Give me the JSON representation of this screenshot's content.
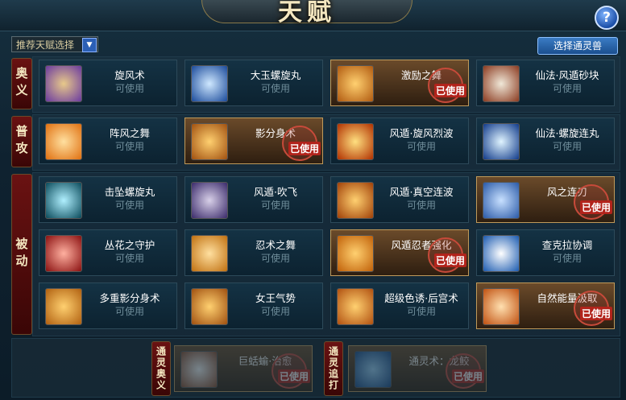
{
  "window": {
    "title": "天赋",
    "help_icon": "?"
  },
  "toolbar": {
    "recommend_select": "推荐天赋选择",
    "select_summon_button": "选择通灵兽"
  },
  "categories": {
    "ougi": "奥义",
    "attack": "普攻",
    "passive": "被动",
    "summon_ougi": "通灵奥义",
    "summon_chase": "通灵追打"
  },
  "status_labels": {
    "available": "可使用",
    "used": "已使用"
  },
  "ougi": [
    {
      "name": "旋风术",
      "status": "可使用",
      "used": false,
      "icon": "tornado-icon"
    },
    {
      "name": "大玉螺旋丸",
      "status": "可使用",
      "used": false,
      "icon": "swirl-icon"
    },
    {
      "name": "激励之舞",
      "status": "已使用",
      "used": true,
      "icon": "dance-icon"
    },
    {
      "name": "仙法·风遁砂块",
      "status": "可使用",
      "used": false,
      "icon": "wind-sand-icon"
    }
  ],
  "attack": [
    {
      "name": "阵风之舞",
      "status": "可使用",
      "used": false,
      "icon": "gust-icon"
    },
    {
      "name": "影分身术",
      "status": "已使用",
      "used": true,
      "icon": "clone-icon"
    },
    {
      "name": "风遁·旋风烈波",
      "status": "可使用",
      "used": false,
      "icon": "slash-icon"
    },
    {
      "name": "仙法·螺旋连丸",
      "status": "可使用",
      "used": false,
      "icon": "rasengan-icon"
    }
  ],
  "passive": [
    {
      "name": "击坠螺旋丸",
      "status": "可使用",
      "used": false,
      "icon": "vortex-icon"
    },
    {
      "name": "风遁·吹飞",
      "status": "可使用",
      "used": false,
      "icon": "fan-icon"
    },
    {
      "name": "风遁·真空连波",
      "status": "可使用",
      "used": false,
      "icon": "wave-icon"
    },
    {
      "name": "风之连刃",
      "status": "已使用",
      "used": true,
      "icon": "blade-icon"
    },
    {
      "name": "丛花之守护",
      "status": "可使用",
      "used": false,
      "icon": "flower-guard-icon"
    },
    {
      "name": "忍术之舞",
      "status": "可使用",
      "used": false,
      "icon": "scroll-icon"
    },
    {
      "name": "风遁忍者强化",
      "status": "已使用",
      "used": true,
      "icon": "wind-kanji-icon"
    },
    {
      "name": "查克拉协调",
      "status": "可使用",
      "used": false,
      "icon": "hand-icon"
    },
    {
      "name": "多重影分身术",
      "status": "可使用",
      "used": false,
      "icon": "multi-clone-icon"
    },
    {
      "name": "女王气势",
      "status": "可使用",
      "used": false,
      "icon": "queen-icon"
    },
    {
      "name": "超级色诱·后宫术",
      "status": "可使用",
      "used": false,
      "icon": "sexy-jutsu-icon"
    },
    {
      "name": "自然能量汲取",
      "status": "已使用",
      "used": true,
      "icon": "clock-icon"
    }
  ],
  "summon": [
    {
      "name": "巨蛞蝓·治愈",
      "status": "已使用",
      "used": true,
      "icon": "slug-icon"
    },
    {
      "name": "通灵术：龙鲛",
      "status": "已使用",
      "used": true,
      "icon": "shark-icon"
    }
  ],
  "colors": {
    "card_available": "#0c2230",
    "card_used": "#6a4a2a",
    "stamp": "#b2231b",
    "category_bg": "#6a1212"
  }
}
